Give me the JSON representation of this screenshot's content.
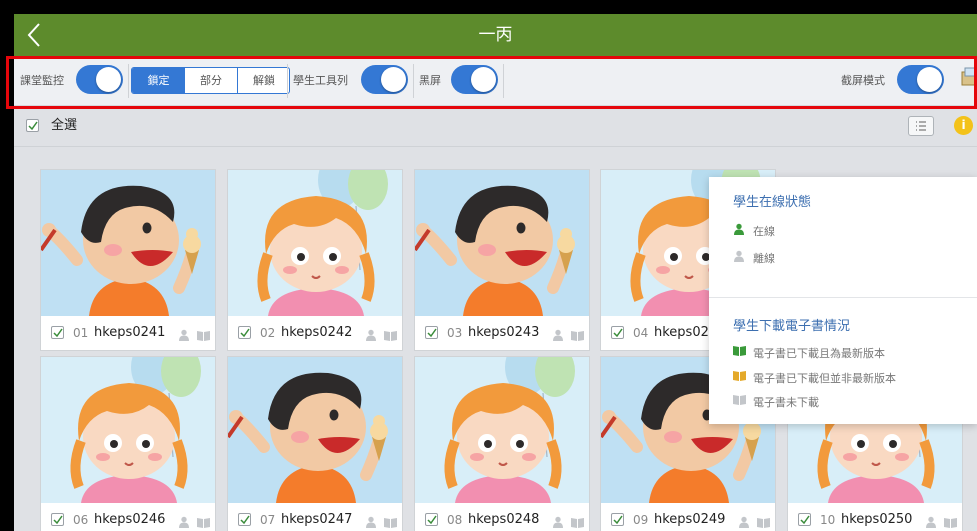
{
  "header": {
    "title": "一丙"
  },
  "toolbar": {
    "monitor_label": "課堂監控",
    "segments": [
      {
        "label": "鎖定",
        "active": true
      },
      {
        "label": "部分",
        "active": false
      },
      {
        "label": "解鎖",
        "active": false
      }
    ],
    "student_toolbar_label": "學生工具列",
    "blackscreen_label": "黑屏",
    "screenshot_mode_label": "截屏模式",
    "accent_color": "#3478d4"
  },
  "selection": {
    "select_all_label": "全選",
    "checked": true
  },
  "students": [
    {
      "num": "01",
      "name": "hkeps0241",
      "avatar": "boy"
    },
    {
      "num": "02",
      "name": "hkeps0242",
      "avatar": "girl"
    },
    {
      "num": "03",
      "name": "hkeps0243",
      "avatar": "boy"
    },
    {
      "num": "04",
      "name": "hkeps02",
      "avatar": "girl"
    },
    {
      "num": "06",
      "name": "hkeps0246",
      "avatar": "girl"
    },
    {
      "num": "07",
      "name": "hkeps0247",
      "avatar": "boy"
    },
    {
      "num": "08",
      "name": "hkeps0248",
      "avatar": "girl"
    },
    {
      "num": "09",
      "name": "hkeps0249",
      "avatar": "boy"
    },
    {
      "num": "10",
      "name": "hkeps0250",
      "avatar": "girl"
    }
  ],
  "popover": {
    "online_heading": "學生在線狀態",
    "online": "在線",
    "offline": "離線",
    "ebook_heading": "學生下載電子書情況",
    "ebook_latest": "電子書已下載且為最新版本",
    "ebook_outdated": "電子書已下載但並非最新版本",
    "ebook_none": "電子書未下載",
    "colors": {
      "online": "#3a9a3a",
      "latest": "#3a9a3a",
      "outdated": "#e4a92a",
      "none": "#c3c6ca"
    }
  }
}
